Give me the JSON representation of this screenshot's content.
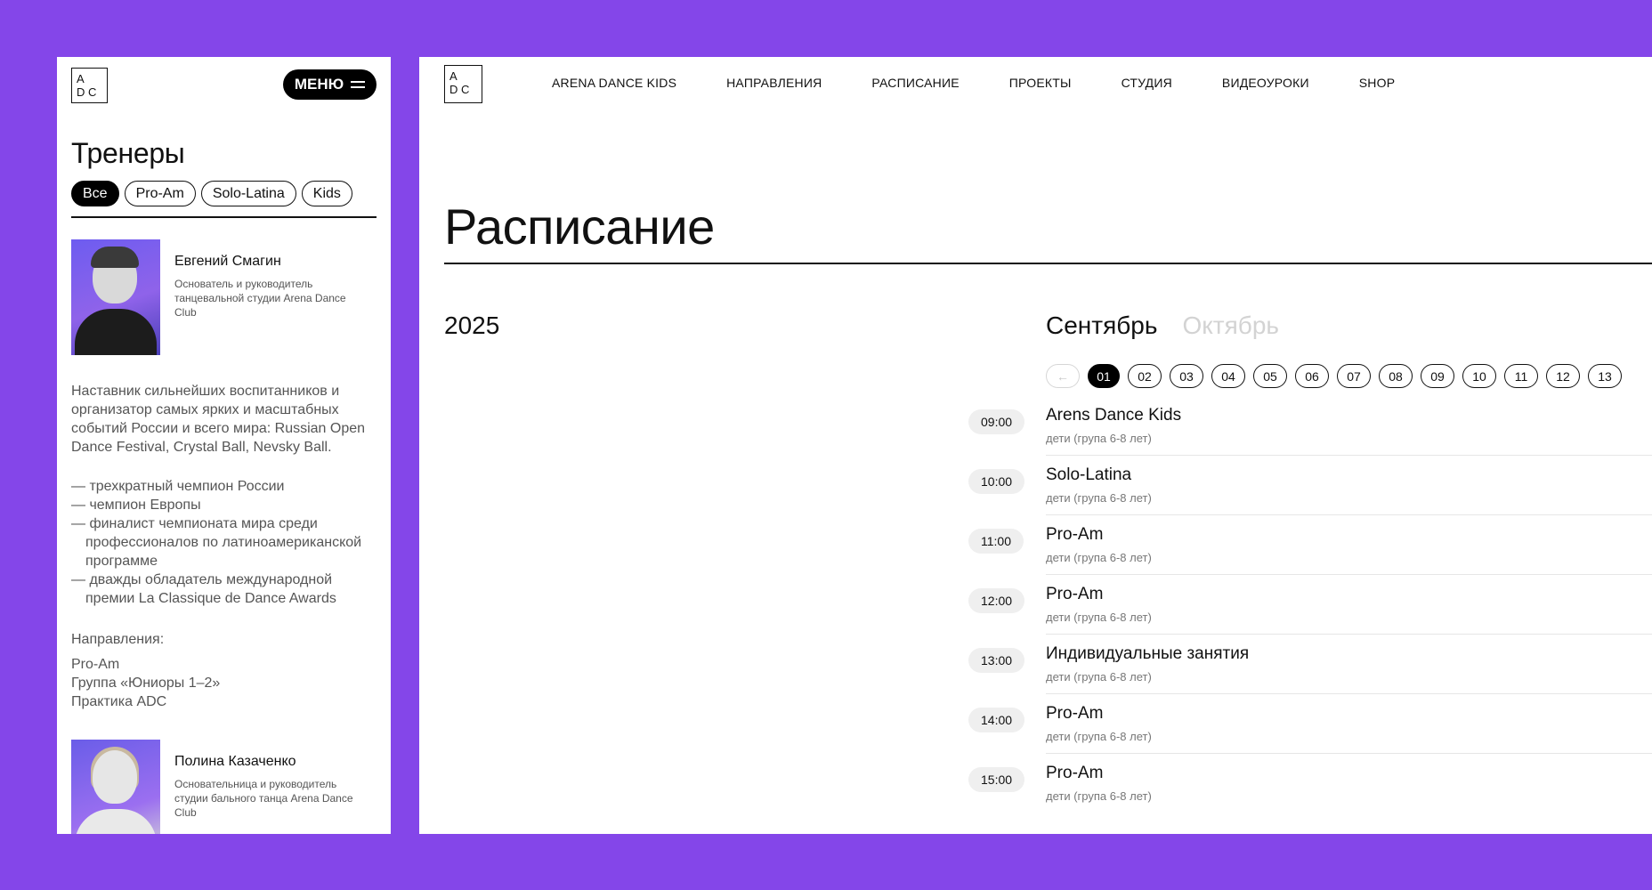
{
  "colors": {
    "background": "#8446e9",
    "panel": "#ffffff",
    "text": "#111111",
    "muted": "#777777",
    "inactive_month": "#d3d3d3"
  },
  "logo": {
    "line1": "A",
    "line2": "D C"
  },
  "mobile": {
    "menu_label": "МЕНЮ",
    "menu_icon": "hamburger-icon",
    "title": "Тренеры",
    "filters": [
      "Все",
      "Pro-Am",
      "Solo-Latina",
      "Kids"
    ],
    "active_filter": "Все",
    "trainers": [
      {
        "name": "Евгений Смагин",
        "role": "Основатель  и руководитель танцевальной студии Arena Dance Club",
        "bio": "Наставник сильнейших воспитанников и организатор самых ярких и масштабных событий России и всего мира: Russian Open Dance Festival, Crystal Ball, Nevsky Ball.",
        "achievements": [
          "— трехкратный чемпион России",
          "— чемпион Европы",
          "— финалист чемпионата мира среди профессионалов по латиноамериканской программе",
          "— дважды обладатель международной премии La Classique de Dance Awards"
        ],
        "directions_label": "Направления:",
        "directions": [
          "Pro-Am",
          "Группа «Юниоры 1–2»",
          "Практика ADC"
        ]
      },
      {
        "name": "Полина Казаченко",
        "role": "Основательница и руководитель студии бального танца Arena Dance Club"
      }
    ]
  },
  "desktop": {
    "nav": [
      "ARENA DANCE KIDS",
      "НАПРАВЛЕНИЯ",
      "РАСПИСАНИЕ",
      "ПРОЕКТЫ",
      "СТУДИЯ",
      "ВИДЕОУРОКИ",
      "SHOP"
    ],
    "title": "Расписание",
    "year": "2025",
    "months": {
      "active": "Сентябрь",
      "inactive": "Октябрь"
    },
    "prev_arrow": "←",
    "days": [
      "01",
      "02",
      "03",
      "04",
      "05",
      "06",
      "07",
      "08",
      "09",
      "10",
      "11",
      "12",
      "13"
    ],
    "active_day": "01",
    "schedule": [
      {
        "time": "09:00",
        "title": "Arens Dance Kids",
        "subtitle": "дети (група 6-8 лет)"
      },
      {
        "time": "10:00",
        "title": "Solo-Latina",
        "subtitle": "дети (група 6-8 лет)"
      },
      {
        "time": "11:00",
        "title": "Pro-Am",
        "subtitle": "дети (група 6-8 лет)"
      },
      {
        "time": "12:00",
        "title": "Pro-Am",
        "subtitle": "дети (група 6-8 лет)"
      },
      {
        "time": "13:00",
        "title": "Индивидуальные занятия",
        "subtitle": "дети (група 6-8 лет)"
      },
      {
        "time": "14:00",
        "title": "Pro-Am",
        "subtitle": "дети (група 6-8 лет)"
      },
      {
        "time": "15:00",
        "title": "Pro-Am",
        "subtitle": "дети (група 6-8 лет)"
      }
    ]
  }
}
